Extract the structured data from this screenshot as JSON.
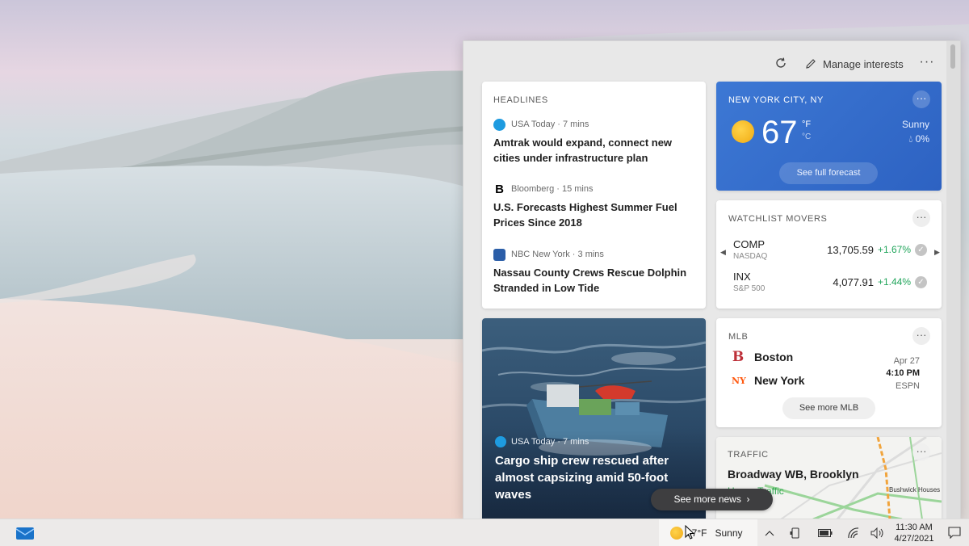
{
  "panel": {
    "manage_label": "Manage interests",
    "more": "···"
  },
  "headlines": {
    "title": "HEADLINES",
    "stories": [
      {
        "source": "USA Today · 7 mins",
        "headline": "Amtrak would expand, connect new cities under infrastructure plan",
        "logo_color": "#1e9be0"
      },
      {
        "source": "Bloomberg · 15 mins",
        "headline": "U.S. Forecasts Highest Summer Fuel Prices Since 2018",
        "logo_letter": "B"
      },
      {
        "source": "NBC New York · 3 mins",
        "headline": "Nassau County Crews Rescue Dolphin Stranded in Low Tide",
        "logo_color": "#2b5ea8"
      }
    ]
  },
  "image_story": {
    "source": "USA Today · 7 mins",
    "headline": "Cargo ship crew rescued after almost capsizing amid 50-foot waves"
  },
  "weather": {
    "location": "NEW YORK CITY, NY",
    "temperature": "67",
    "unit_f": "°F",
    "unit_c": "°C",
    "condition": "Sunny",
    "precip": "0%",
    "forecast_label": "See full forecast",
    "more": "···"
  },
  "watchlist": {
    "title": "WATCHLIST MOVERS",
    "more": "···",
    "items": [
      {
        "symbol": "COMP",
        "exchange": "NASDAQ",
        "price": "13,705.59",
        "change": "+1.67%"
      },
      {
        "symbol": "INX",
        "exchange": "S&P 500",
        "price": "4,077.91",
        "change": "+1.44%"
      }
    ],
    "accent_positive": "#21a55b"
  },
  "mlb": {
    "title": "MLB",
    "more": "···",
    "teams": [
      {
        "name": "Boston",
        "logo": "B",
        "color": "#bd3039"
      },
      {
        "name": "New York",
        "logo": "NY",
        "color": "#ff5910"
      }
    ],
    "date": "Apr 27",
    "time": "4:10 PM",
    "network": "ESPN",
    "see_more_label": "See more MLB"
  },
  "traffic": {
    "title": "TRAFFIC",
    "more": "···",
    "road": "Broadway WB, Brooklyn",
    "status": "Heavy Traffic",
    "place": "Bushwick Houses"
  },
  "see_more_news": "See more news",
  "taskbar": {
    "weather_temp": "67°F",
    "weather_cond": "Sunny",
    "time": "11:30 AM",
    "date": "4/27/2021"
  }
}
